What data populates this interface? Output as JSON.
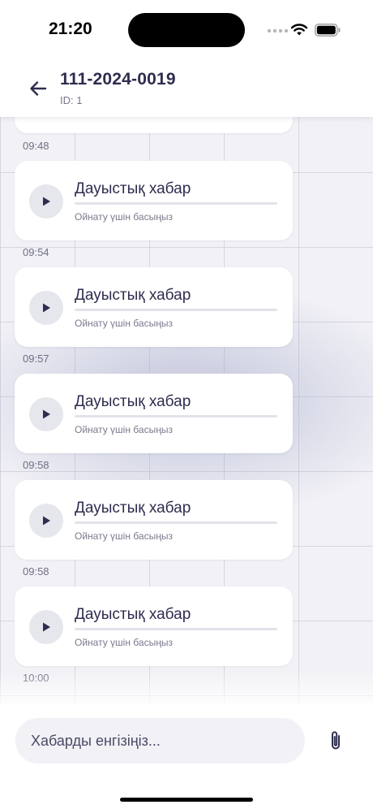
{
  "status_bar": {
    "time": "21:20"
  },
  "header": {
    "title": "111-2024-0019",
    "subtitle": "ID: 1",
    "back_icon": "arrow-left-icon"
  },
  "messages": [
    {
      "time": "09:48",
      "title": "Дауыстық хабар",
      "hint": "Ойнату үшін басыңыз",
      "progress": 0
    },
    {
      "time": "09:54",
      "title": "Дауыстық хабар",
      "hint": "Ойнату үшін басыңыз",
      "progress": 0
    },
    {
      "time": "09:57",
      "title": "Дауыстық хабар",
      "hint": "Ойнату үшін басыңыз",
      "progress": 0
    },
    {
      "time": "09:58",
      "title": "Дауыстық хабар",
      "hint": "Ойнату үшін басыңыз",
      "progress": 0
    },
    {
      "time": "09:58",
      "title": "Дауыстық хабар",
      "hint": "Ойнату үшін басыңыз",
      "progress": 0
    }
  ],
  "last_timestamp": "10:00",
  "composer": {
    "placeholder": "Хабарды енгізіңіз...",
    "value": "",
    "attach_icon": "paperclip-icon"
  },
  "colors": {
    "text_primary": "#2e2d4f",
    "text_secondary": "#7a7a8e",
    "play_button_bg": "#e6e6ed",
    "input_bg": "#f1f1f6"
  }
}
